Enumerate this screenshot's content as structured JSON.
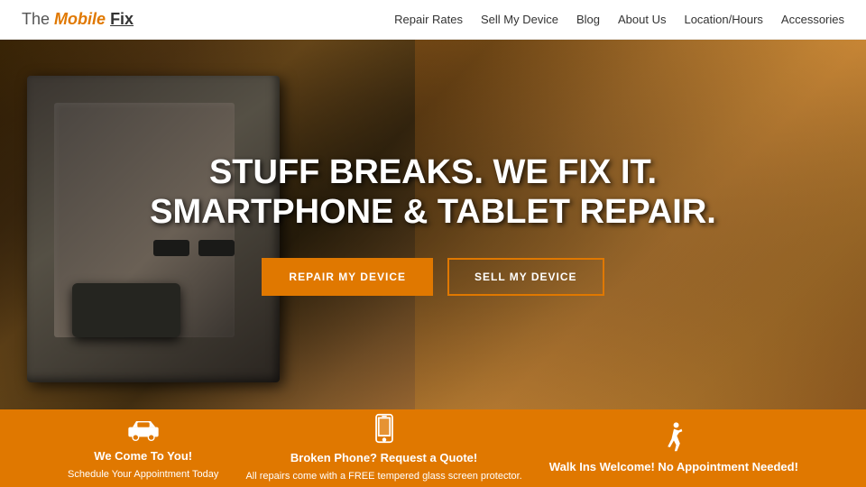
{
  "header": {
    "logo": {
      "the": "The",
      "mobile": "Mobile",
      "fix": "Fix"
    },
    "nav": {
      "items": [
        {
          "label": "Repair Rates",
          "href": "#"
        },
        {
          "label": "Sell My Device",
          "href": "#"
        },
        {
          "label": "Blog",
          "href": "#"
        },
        {
          "label": "About Us",
          "href": "#"
        },
        {
          "label": "Location/Hours",
          "href": "#"
        },
        {
          "label": "Accessories",
          "href": "#"
        }
      ]
    }
  },
  "hero": {
    "title_line1": "STUFF BREAKS. WE FIX IT.",
    "title_line2": "SMARTPHONE & TABLET REPAIR.",
    "button1": "REPAIR MY DEVICE",
    "button2": "SELL MY DEVICE"
  },
  "bottom_bar": {
    "items": [
      {
        "icon": "car",
        "bold_text": "We Come To You!",
        "normal_text": "Schedule Your Appointment Today"
      },
      {
        "icon": "phone",
        "bold_text": "Broken Phone? Request a Quote!",
        "normal_text": "All repairs come with a FREE tempered glass screen protector."
      },
      {
        "icon": "walk",
        "bold_text": "Walk Ins Welcome! No Appointment Needed!",
        "normal_text": ""
      }
    ]
  }
}
